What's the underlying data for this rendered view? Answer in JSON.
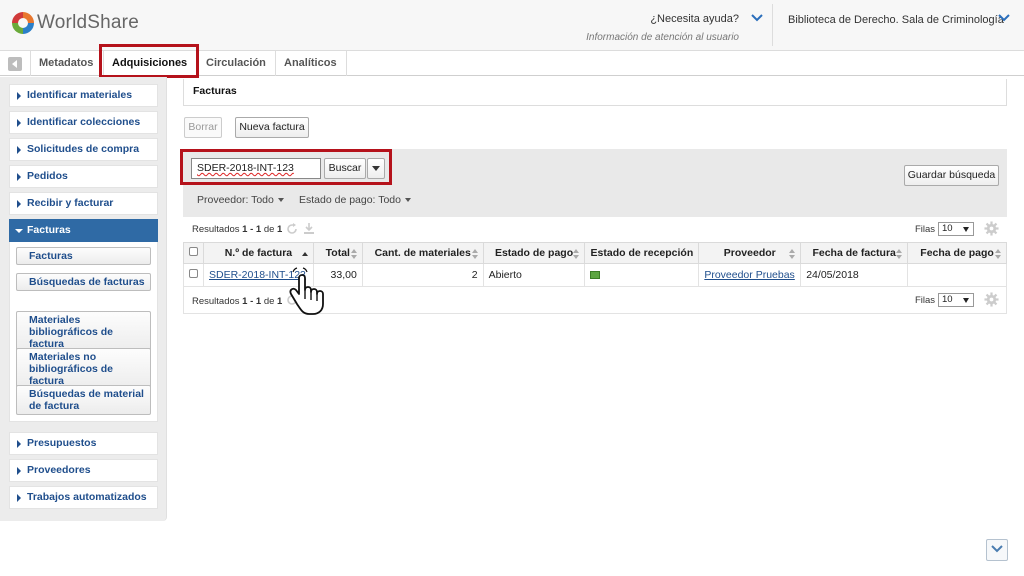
{
  "header": {
    "logo_text": "WorldShare",
    "help_title": "¿Necesita ayuda?",
    "help_subtitle": "Información de atención al usuario",
    "library": "Biblioteca de Derecho. Sala de Criminología"
  },
  "tabs": [
    {
      "label": "Metadatos"
    },
    {
      "label": "Adquisiciones"
    },
    {
      "label": "Circulación"
    },
    {
      "label": "Analíticos"
    }
  ],
  "sidebar": {
    "items_top": [
      {
        "label": "Identificar materiales"
      },
      {
        "label": "Identificar colecciones"
      },
      {
        "label": "Solicitudes de compra"
      },
      {
        "label": "Pedidos"
      },
      {
        "label": "Recibir y facturar"
      },
      {
        "label": "Facturas"
      }
    ],
    "sub_items": [
      {
        "label": "Facturas"
      },
      {
        "label": "Búsquedas de facturas"
      },
      {
        "label": "Materiales bibliográficos de factura"
      },
      {
        "label": "Materiales no bibliográficos de factura"
      },
      {
        "label": "Búsquedas de material de factura"
      }
    ],
    "items_bottom": [
      {
        "label": "Presupuestos"
      },
      {
        "label": "Proveedores"
      },
      {
        "label": "Trabajos automatizados"
      }
    ]
  },
  "main": {
    "panel_title": "Facturas",
    "delete_label": "Borrar",
    "new_invoice_label": "Nueva factura",
    "search_value": "SDER-2018-INT-123",
    "search_button": "Buscar",
    "save_search_label": "Guardar búsqueda",
    "filter_vendor": "Proveedor: Todo",
    "filter_payment": "Estado de pago: Todo",
    "results_prefix": "Resultados",
    "results_range": "1 - 1",
    "results_of": "de",
    "results_total": "1",
    "rows_label": "Filas",
    "rows_value": "10"
  },
  "table": {
    "headers": [
      "N.º de factura",
      "Total",
      "Cant. de materiales",
      "Estado de pago",
      "Estado de recepción",
      "Proveedor",
      "Fecha de factura",
      "Fecha de pago"
    ],
    "rows": [
      {
        "invoice_no": "SDER-2018-INT-123",
        "total": "33,00",
        "item_count": "2",
        "payment_status": "Abierto",
        "vendor": "Proveedor Pruebas",
        "invoice_date": "24/05/2018",
        "payment_date": ""
      }
    ]
  },
  "colors": {
    "highlight_box": "#b5121b",
    "nav_active": "#2f6aa5",
    "link": "#1f4e8c"
  }
}
